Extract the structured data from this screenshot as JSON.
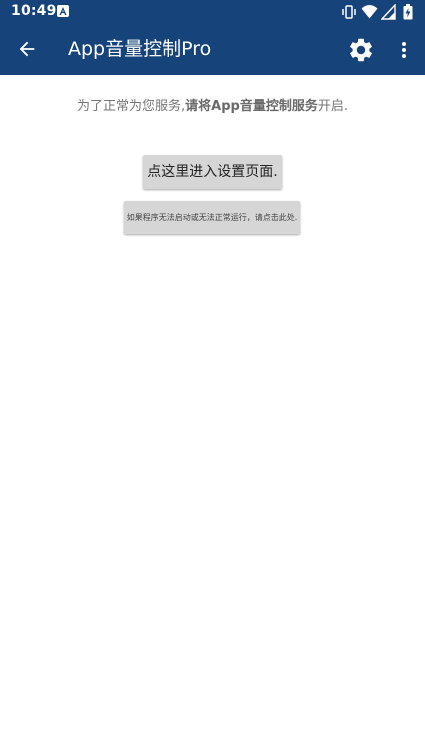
{
  "status_bar": {
    "time": "10:49",
    "icons": [
      "notification-a-icon",
      "vibrate-icon",
      "wifi-icon",
      "signal-icon",
      "battery-icon"
    ]
  },
  "app_bar": {
    "title": "App音量控制Pro",
    "icons": [
      "back-arrow-icon",
      "gear-icon",
      "more-vert-icon"
    ],
    "background_color": "#15437a"
  },
  "content": {
    "message_prefix": "为了正常为您服务,",
    "message_strong": "请将App音量控制服务",
    "message_suffix": "开启.",
    "primary_button_label": "点这里进入设置页面.",
    "secondary_button_label": "如果程序无法启动或无法正常运行，请点击此处."
  }
}
